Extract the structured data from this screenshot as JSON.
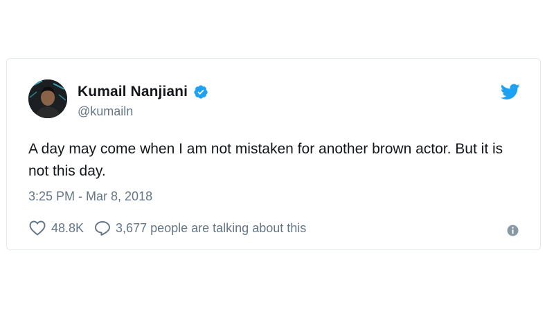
{
  "author": {
    "display_name": "Kumail Nanjiani",
    "handle": "@kumailn",
    "verified": true,
    "avatar_icon": "avatar-photo"
  },
  "tweet": {
    "text": "A day may come when I am not mistaken for another brown actor. But it is not this day.",
    "timestamp": "3:25 PM - Mar 8, 2018"
  },
  "actions": {
    "like_count": "48.8K",
    "talking_text": "3,677 people are talking about this"
  },
  "icons": {
    "brand": "twitter-bird-icon",
    "verified": "verified-badge-icon",
    "like": "heart-icon",
    "reply": "comment-bubble-icon",
    "info": "info-icon"
  },
  "colors": {
    "brand_blue": "#1da1f2",
    "text_primary": "#14171a",
    "text_secondary": "#657786",
    "border": "#e1e8ed"
  }
}
